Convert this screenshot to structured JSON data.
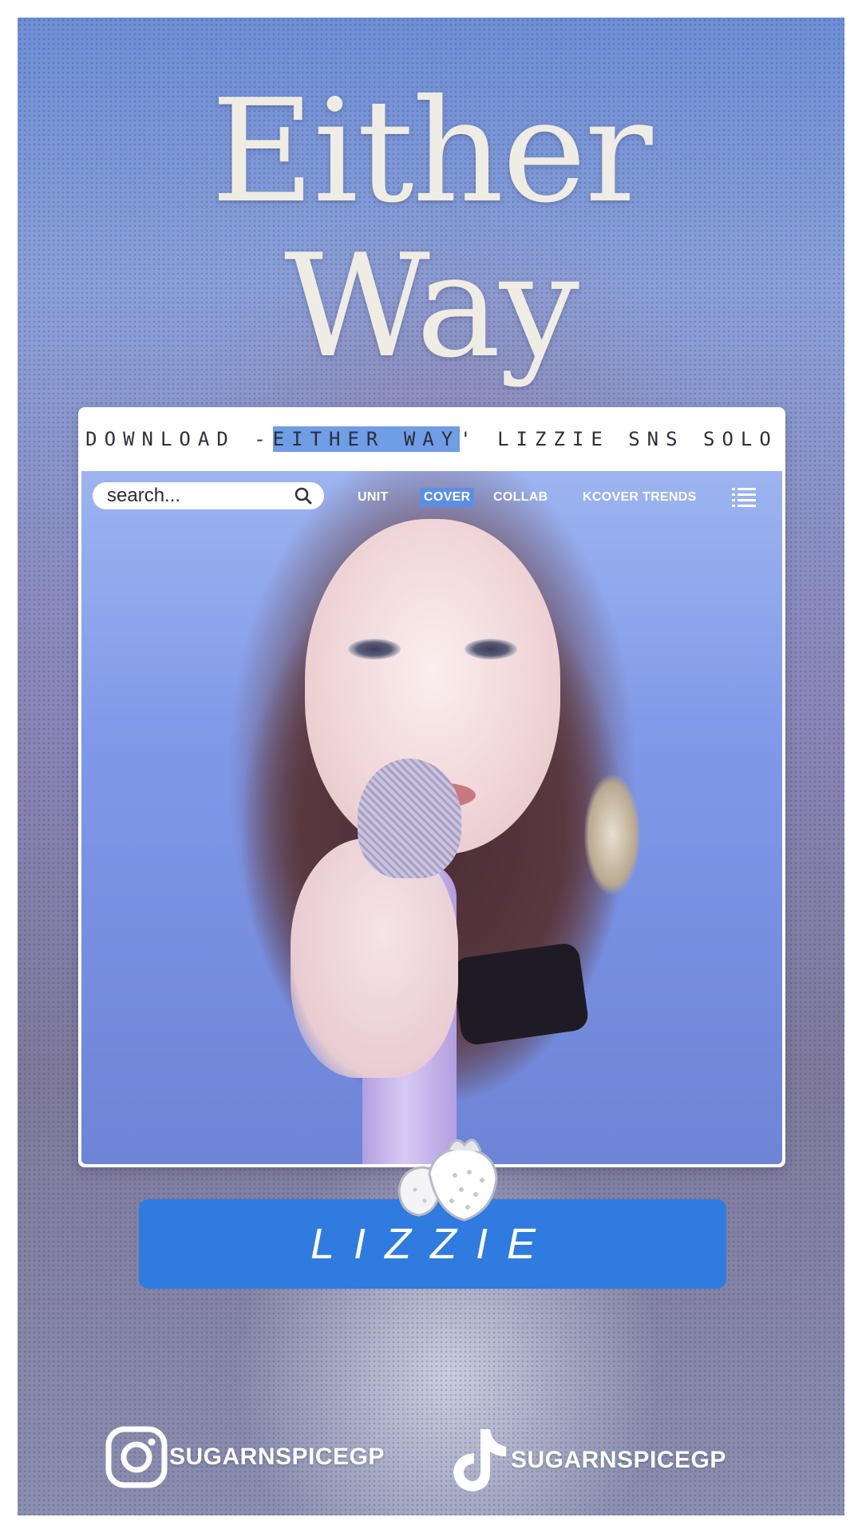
{
  "title": {
    "line1": "Either",
    "line2": "Way"
  },
  "ticker": {
    "prefix": "DOWNLOAD - ",
    "highlight": "EITHER WAY",
    "suffix": "' LIZZIE SNS SOLO"
  },
  "search": {
    "placeholder": "search..."
  },
  "nav": {
    "unit": "UNIT",
    "cover": "COVER",
    "collab": "COLLAB",
    "kcover_trends": "KCOVER TRENDS"
  },
  "name_label": "LIZZIE",
  "socials": {
    "instagram_handle": "SUGARNSPICEGP",
    "tiktok_handle": "SUGARNSPICEGP"
  },
  "colors": {
    "accent": "#2f7be0",
    "highlight": "#6f9de6",
    "title_text": "#efece4"
  }
}
